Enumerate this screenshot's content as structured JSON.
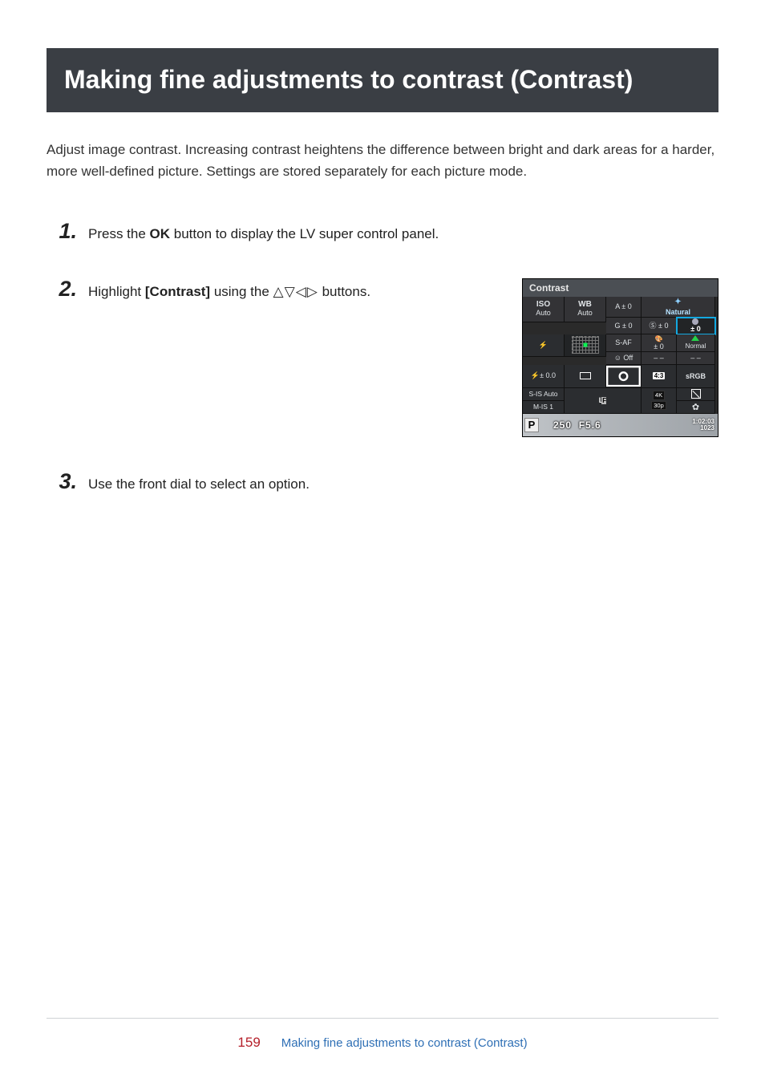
{
  "title": "Making fine adjustments to contrast (Contrast)",
  "intro": "Adjust image contrast. Increasing contrast heightens the difference between bright and dark areas for a harder, more well-defined picture. Settings are stored separately for each picture mode.",
  "steps": {
    "s1": {
      "num": "1",
      "pre": "Press the ",
      "bold": "OK",
      "post": " button to display the LV super control panel."
    },
    "s2": {
      "num": "2",
      "pre": "Highlight ",
      "bold": "[Contrast]",
      "mid": " using the ",
      "arrows": "△▽◁▷",
      "post": " buttons."
    },
    "s3": {
      "num": "3",
      "text": "Use the front dial to select an option."
    }
  },
  "panel": {
    "header": "Contrast",
    "iso_lbl": "ISO",
    "iso_val": "Auto",
    "wb_lbl": "WB",
    "wb_val": "Auto",
    "a": "A ± 0",
    "g": "G ± 0",
    "saf": "S-AF",
    "face": "☺ Off",
    "picmode": "Natural",
    "sharp": "Ⓢ ± 0",
    "contrast": "± 0",
    "sat": "± 0",
    "normal": "Normal",
    "dash": "– –",
    "flash": "⚡± 0.0",
    "ratio": "4:3",
    "srgb": "sRGB",
    "sis": "S-IS Auto",
    "mis": "M-IS 1",
    "lf": "L",
    "lf_f": "F",
    "vid1": "4K",
    "vid2": "30p",
    "footer_mode": "P",
    "footer_shutter": "250",
    "footer_f": "F5.6",
    "footer_time": "1:02:03",
    "footer_shots": "1023"
  },
  "footer": {
    "page": "159",
    "link": "Making fine adjustments to contrast (Contrast)"
  }
}
